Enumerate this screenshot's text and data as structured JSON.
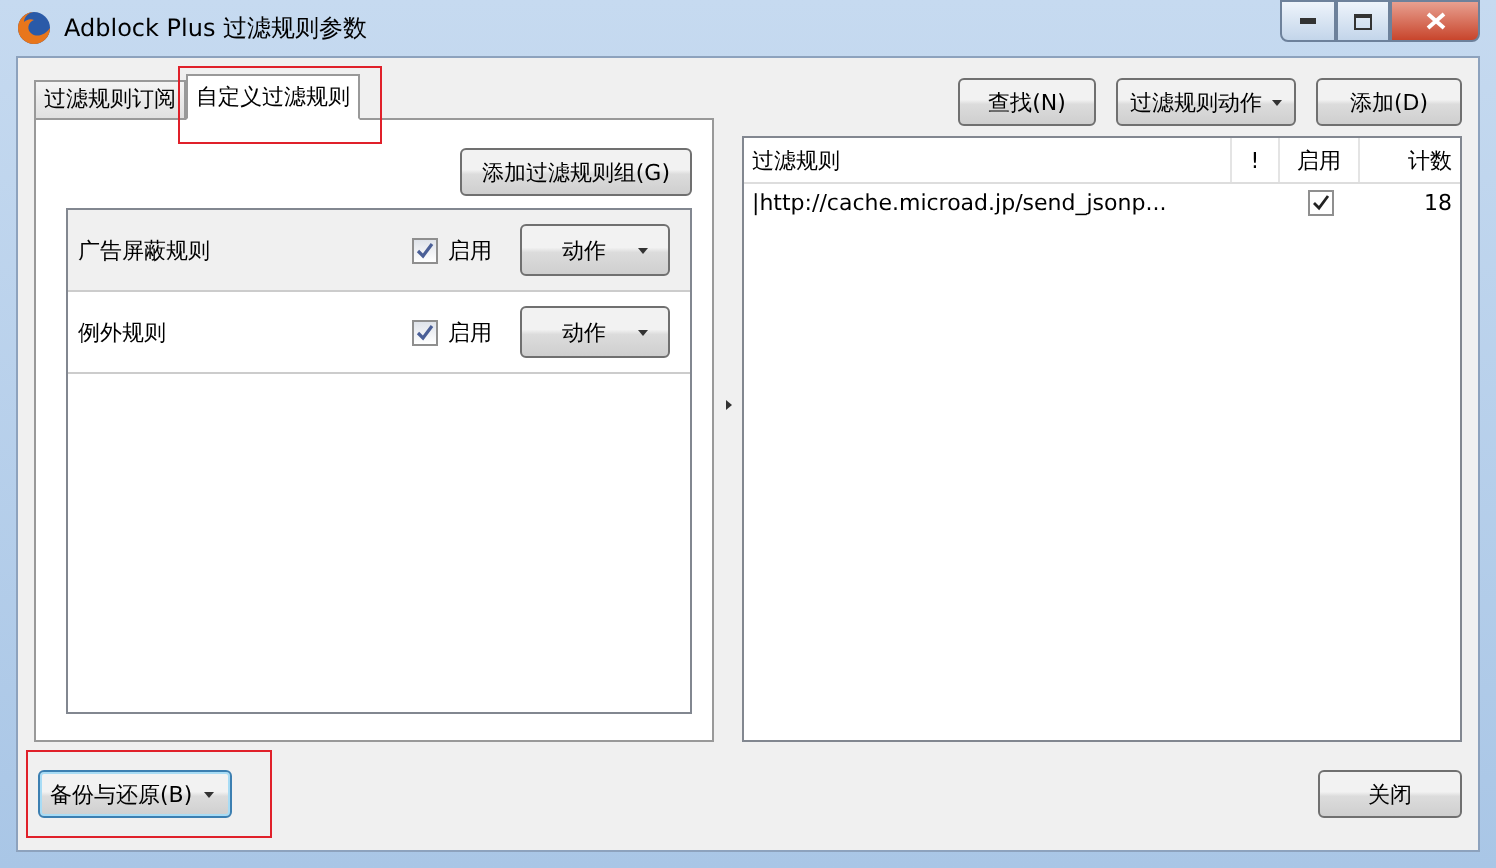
{
  "window": {
    "title": "Adblock Plus 过滤规则参数"
  },
  "tabs": [
    {
      "label": "过滤规则订阅",
      "selected": false,
      "highlighted": false
    },
    {
      "label": "自定义过滤规则",
      "selected": true,
      "highlighted": true
    }
  ],
  "add_group_button": "添加过滤规则组(G)",
  "groups": [
    {
      "name": "广告屏蔽规则",
      "enabled_label": "启用",
      "checked": true,
      "action": "动作",
      "selected": true
    },
    {
      "name": "例外规则",
      "enabled_label": "启用",
      "checked": true,
      "action": "动作",
      "selected": false
    }
  ],
  "toolbar": {
    "find": "查找(N)",
    "actions": "过滤规则动作",
    "add": "添加(D)"
  },
  "table": {
    "columns": [
      "过滤规则",
      "!",
      "启用",
      "计数"
    ],
    "rows": [
      {
        "filter": "|http://cache.microad.jp/send_jsonp...",
        "enabled": true,
        "count": "18"
      }
    ]
  },
  "backup_button": {
    "label": "备份与还原(B)",
    "highlighted": true
  },
  "close_button": "关闭"
}
